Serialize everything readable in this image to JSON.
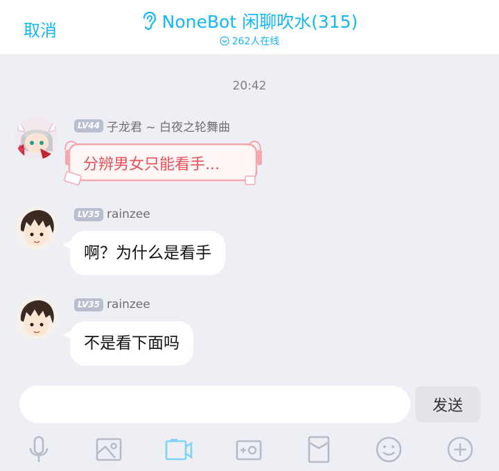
{
  "header": {
    "cancel_label": "取消",
    "title": "NoneBot 闲聊吹水(315)",
    "online": "262人在线"
  },
  "time_divider": "20:42",
  "messages": [
    {
      "level": "LV44",
      "name": "子龙君 ~ 白夜之轮舞曲",
      "text": "分辨男女只能看手..."
    },
    {
      "level": "LV35",
      "name": "rainzee",
      "text": "啊？为什么是看手"
    },
    {
      "level": "LV35",
      "name": "rainzee",
      "text": "不是看下面吗"
    }
  ],
  "input": {
    "value": "",
    "send_label": "发送"
  },
  "toolbar": [
    "mic-icon",
    "image-icon",
    "video-icon",
    "camera-icon",
    "red-packet-icon",
    "emoji-icon",
    "plus-icon"
  ],
  "colors": {
    "accent": "#12b7f5",
    "background": "#eeeef5",
    "fancy_text": "#e5505a"
  }
}
